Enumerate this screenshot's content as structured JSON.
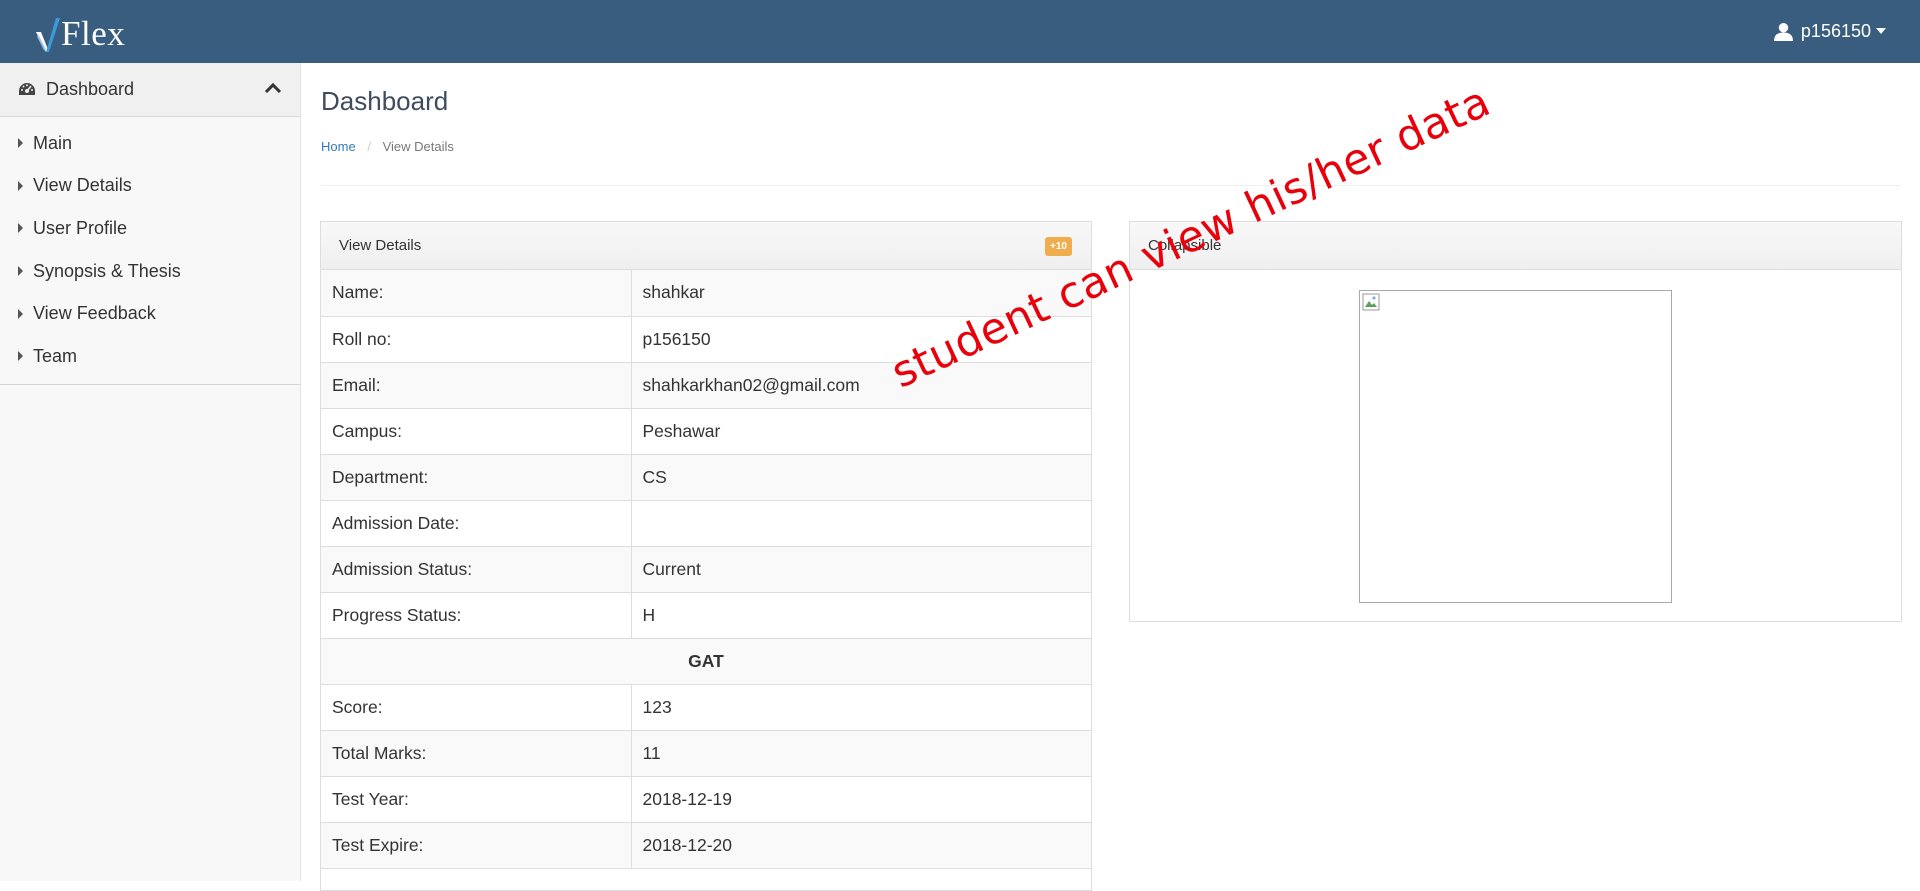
{
  "brand": {
    "name": "Flex"
  },
  "user": {
    "username": "p156150"
  },
  "sidebar": {
    "header_label": "Dashboard",
    "items": [
      {
        "label": "Main"
      },
      {
        "label": "View Details"
      },
      {
        "label": "User Profile"
      },
      {
        "label": "Synopsis & Thesis"
      },
      {
        "label": "View Feedback"
      },
      {
        "label": "Team"
      }
    ]
  },
  "page": {
    "title": "Dashboard",
    "breadcrumb": {
      "home": "Home",
      "separator": "/",
      "current": "View Details"
    }
  },
  "details_panel": {
    "title": "View Details",
    "badge": "+10",
    "rows": [
      {
        "label": "Name:",
        "value": "shahkar"
      },
      {
        "label": "Roll no:",
        "value": "p156150"
      },
      {
        "label": "Email:",
        "value": "shahkarkhan02@gmail.com"
      },
      {
        "label": "Campus:",
        "value": "Peshawar"
      },
      {
        "label": "Department:",
        "value": "CS"
      },
      {
        "label": "Admission Date:",
        "value": ""
      },
      {
        "label": "Admission Status:",
        "value": "Current"
      },
      {
        "label": "Progress Status:",
        "value": "H"
      }
    ],
    "gat_section": "GAT",
    "gat_rows": [
      {
        "label": "Score:",
        "value": "123"
      },
      {
        "label": "Total Marks:",
        "value": "11"
      },
      {
        "label": "Test Year:",
        "value": "2018-12-19"
      },
      {
        "label": "Test Expire:",
        "value": "2018-12-20"
      }
    ]
  },
  "collapsible_panel": {
    "title": "Collapsible"
  },
  "annotation": {
    "text": "student can view his/her data"
  },
  "colors": {
    "navbar": "#385d7e",
    "link": "#337ab7",
    "badge": "#f0ad4e",
    "annotation": "#e8000b"
  }
}
